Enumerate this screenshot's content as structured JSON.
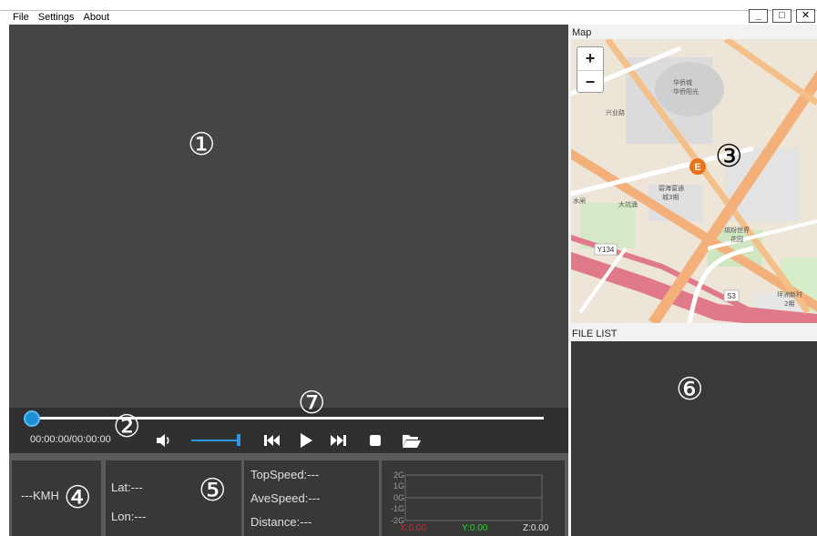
{
  "menu": {
    "file": "File",
    "settings": "Settings",
    "about": "About"
  },
  "window_buttons": {
    "minimize": "_",
    "maximize": "□",
    "close": "✕"
  },
  "player": {
    "timecode": "00:00:00/00:00:00"
  },
  "speed": {
    "value": "---KMH"
  },
  "gps": {
    "lat": "Lat:---",
    "lon": "Lon:---"
  },
  "stats": {
    "top_speed": "TopSpeed:---",
    "ave_speed": "AveSpeed:---",
    "distance": "Distance:---"
  },
  "gsensor": {
    "ticks": [
      "2G",
      "1G",
      "0G",
      "-1G",
      "-2G"
    ],
    "x": "X:0.00",
    "y": "Y:0.00",
    "z": "Z:0.00",
    "colors": {
      "x": "#e02020",
      "y": "#33cc33",
      "z": "#e0e0e0"
    }
  },
  "map": {
    "label": "Map",
    "zoom_in": "+",
    "zoom_out": "−",
    "place_labels": [
      "华侨城",
      "华侨阳光",
      "碧海富通",
      "城3期",
      "大坑涌",
      "缤纷世界",
      "花园",
      "坪洲新村",
      "2期",
      "Y134",
      "S3",
      "兴业路",
      "水闸"
    ],
    "poi_letter": "E"
  },
  "file_list": {
    "label": "FILE LIST"
  },
  "markers": [
    "①",
    "②",
    "③",
    "④",
    "⑤",
    "⑥",
    "⑦"
  ]
}
